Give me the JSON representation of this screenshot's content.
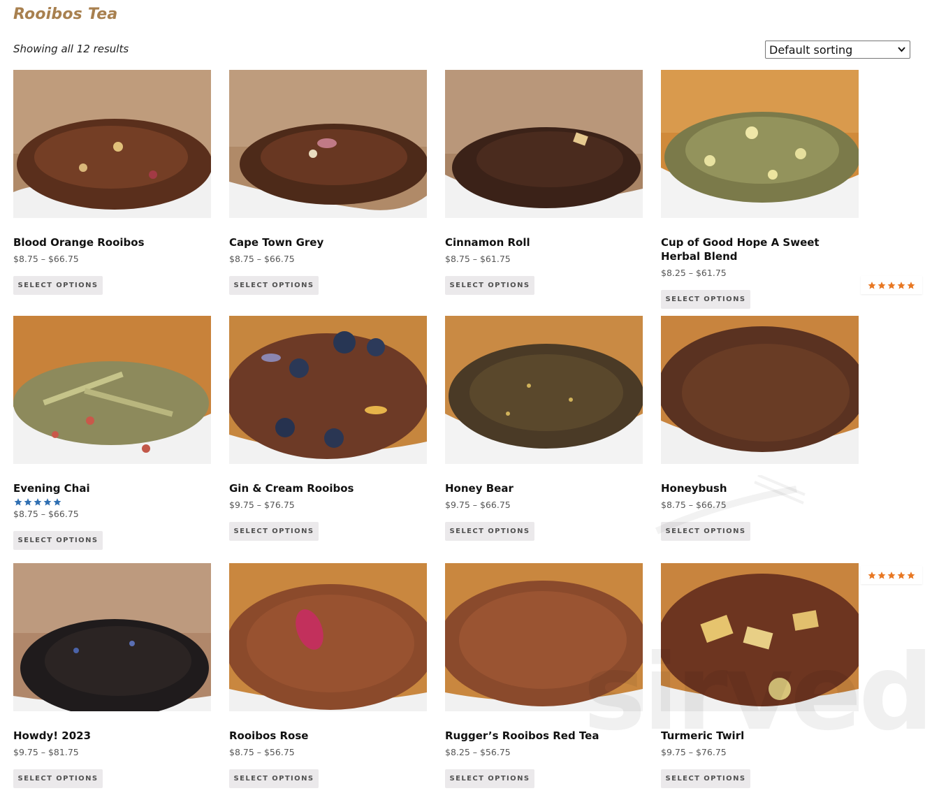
{
  "page": {
    "title": "Rooibos Tea",
    "result_count": "Showing all 12 results",
    "sort_selected": "Default sorting"
  },
  "colors": {
    "title": "#a8804f",
    "button_bg": "#ebe9eb",
    "star_blue": "#2f6fb2",
    "star_orange": "#e87722"
  },
  "products": [
    {
      "name": "Blood Orange Rooibos",
      "price": "$8.75 – $66.75",
      "button": "SELECT OPTIONS"
    },
    {
      "name": "Cape Town Grey",
      "price": "$8.75 – $66.75",
      "button": "SELECT OPTIONS"
    },
    {
      "name": "Cinnamon Roll",
      "price": "$8.75 – $61.75",
      "button": "SELECT OPTIONS"
    },
    {
      "name": "Cup of Good Hope A Sweet Herbal Blend",
      "price": "$8.25 – $61.75",
      "button": "SELECT OPTIONS"
    },
    {
      "name": "Evening Chai",
      "price": "$8.75 – $66.75",
      "button": "SELECT OPTIONS",
      "rating_stars": 5
    },
    {
      "name": "Gin & Cream Rooibos",
      "price": "$9.75 – $76.75",
      "button": "SELECT OPTIONS"
    },
    {
      "name": "Honey Bear",
      "price": "$9.75 – $66.75",
      "button": "SELECT OPTIONS"
    },
    {
      "name": "Honeybush",
      "price": "$8.75 – $66.75",
      "button": "SELECT OPTIONS"
    },
    {
      "name": "Howdy! 2023",
      "price": "$9.75 – $81.75",
      "button": "SELECT OPTIONS"
    },
    {
      "name": "Rooibos Rose",
      "price": "$8.75 – $56.75",
      "button": "SELECT OPTIONS"
    },
    {
      "name": "Rugger’s Rooibos Red Tea",
      "price": "$8.25 – $56.75",
      "button": "SELECT OPTIONS"
    },
    {
      "name": "Turmeric Twirl",
      "price": "$9.75 – $76.75",
      "button": "SELECT OPTIONS"
    }
  ],
  "side_ratings": [
    5,
    5
  ],
  "watermark": "sirved"
}
